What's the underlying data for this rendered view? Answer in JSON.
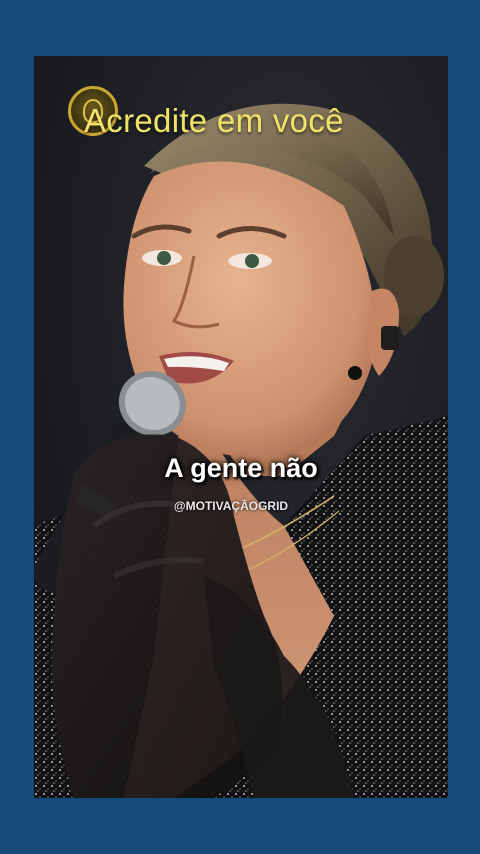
{
  "overlay": {
    "title": "Acredite em você",
    "caption": "A gente não",
    "handle": "@MOTIVAÇÃOGRID"
  },
  "colors": {
    "frame_background": "#164979",
    "title_text": "#f1e36a",
    "caption_text": "#ffffff"
  },
  "icons": {
    "logo": "gold-emblem-icon"
  }
}
